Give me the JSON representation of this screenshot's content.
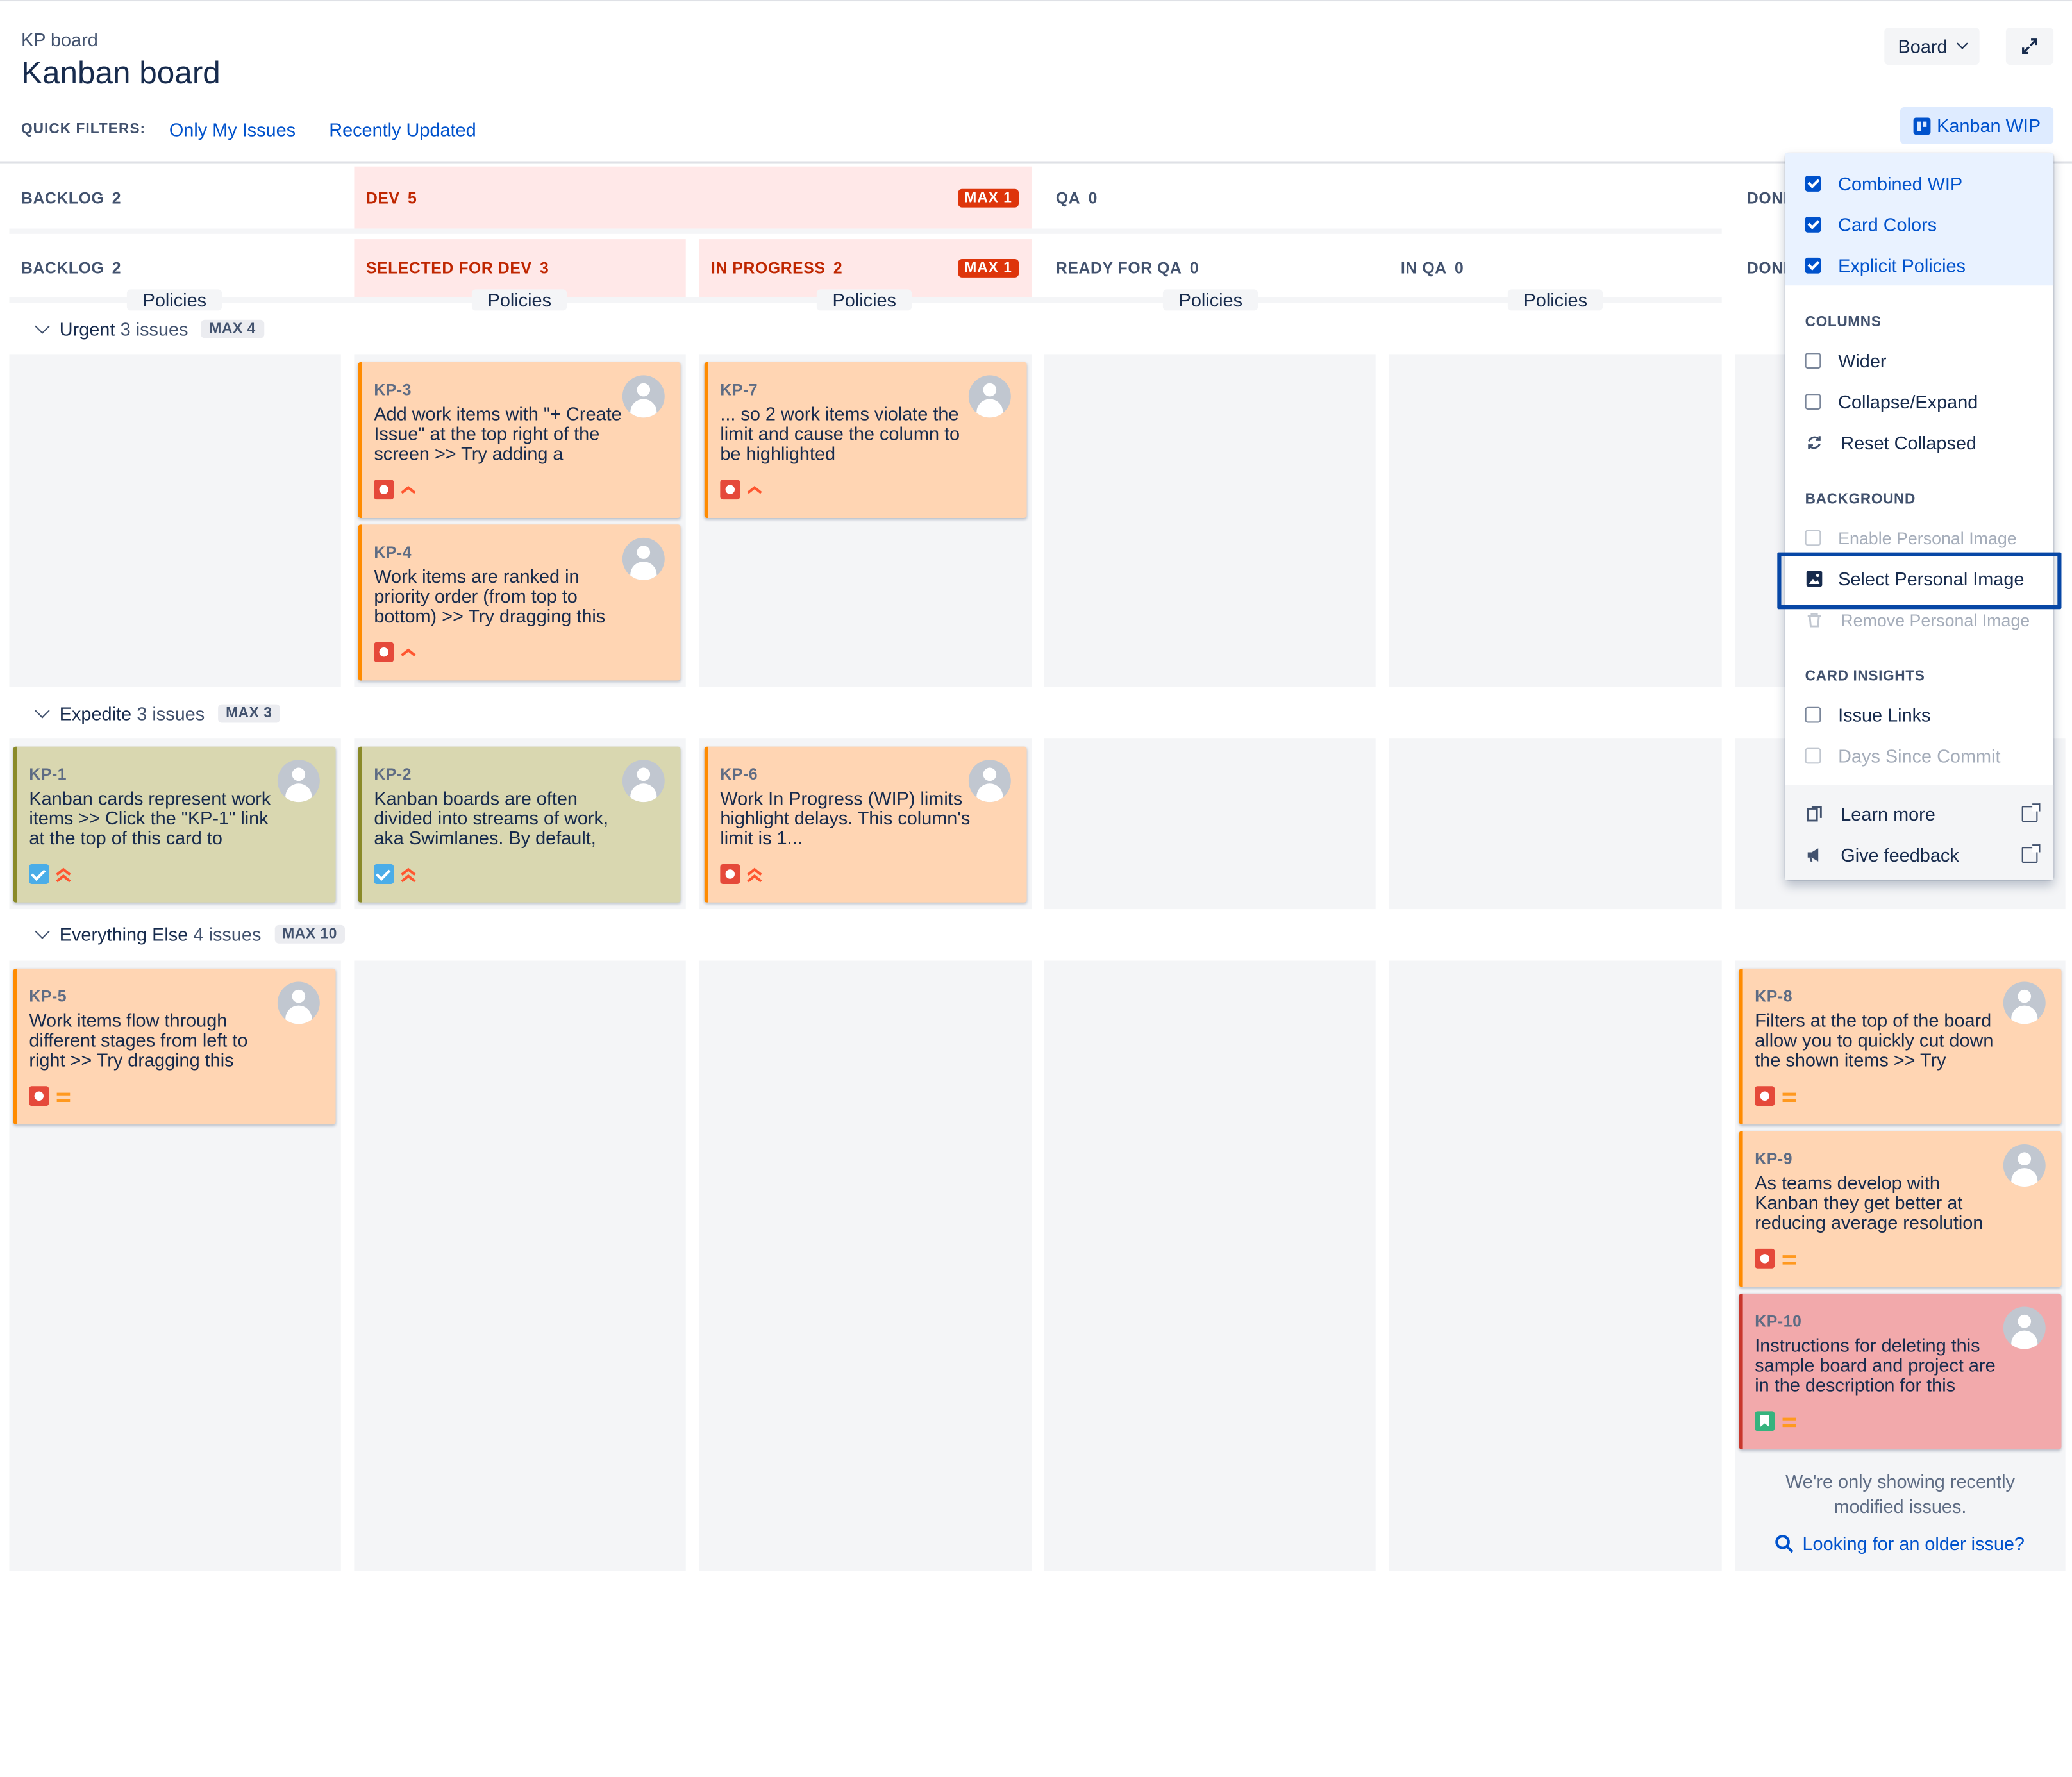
{
  "header": {
    "breadcrumb": "KP board",
    "title": "Kanban board",
    "board_button": "Board",
    "kanban_wip_button": "Kanban WIP"
  },
  "quick_filters": {
    "label": "QUICK FILTERS:",
    "items": [
      "Only My Issues",
      "Recently Updated"
    ]
  },
  "columns": {
    "groups": [
      {
        "name": "BACKLOG",
        "count": "2"
      },
      {
        "name": "DEV",
        "count": "5",
        "max": "MAX 1"
      },
      {
        "name": "QA",
        "count": "0"
      },
      {
        "name": "DONE"
      }
    ],
    "sub": [
      {
        "name": "BACKLOG",
        "count": "2"
      },
      {
        "name": "SELECTED FOR DEV",
        "count": "3"
      },
      {
        "name": "IN PROGRESS",
        "count": "2",
        "max": "MAX 1"
      },
      {
        "name": "READY FOR QA",
        "count": "0"
      },
      {
        "name": "IN QA",
        "count": "0"
      },
      {
        "name": "DONE"
      }
    ],
    "policies_label": "Policies"
  },
  "swimlanes": [
    {
      "name": "Urgent",
      "issues": "3 issues",
      "max": "MAX 4"
    },
    {
      "name": "Expedite",
      "issues": "3 issues",
      "max": "MAX 3"
    },
    {
      "name": "Everything Else",
      "issues": "4 issues",
      "max": "MAX 10"
    }
  ],
  "cards": {
    "kp3": {
      "key": "KP-3",
      "summary": "Add work items with \"+ Create Issue\" at the top right of the screen >> Try adding a",
      "type": "bug",
      "priority": "high"
    },
    "kp4": {
      "key": "KP-4",
      "summary": "Work items are ranked in priority order (from top to bottom) >> Try dragging this",
      "type": "bug",
      "priority": "high"
    },
    "kp7": {
      "key": "KP-7",
      "summary": "... so 2 work items violate the limit and cause the column to be highlighted",
      "type": "bug",
      "priority": "high"
    },
    "kp1": {
      "key": "KP-1",
      "summary": "Kanban cards represent work items >> Click the \"KP-1\" link at the top of this card to",
      "type": "task",
      "priority": "highest"
    },
    "kp2": {
      "key": "KP-2",
      "summary": "Kanban boards are often divided into streams of work, aka Swimlanes. By default,",
      "type": "task",
      "priority": "highest"
    },
    "kp6": {
      "key": "KP-6",
      "summary": "Work In Progress (WIP) limits highlight delays. This column's limit is 1...",
      "type": "bug",
      "priority": "highest"
    },
    "kp5": {
      "key": "KP-5",
      "summary": "Work items flow through different stages from left to right >> Try dragging this",
      "type": "bug",
      "priority": "medium"
    },
    "kp8": {
      "key": "KP-8",
      "summary": "Filters at the top of the board allow you to quickly cut down the shown items >> Try",
      "type": "bug",
      "priority": "medium"
    },
    "kp9": {
      "key": "KP-9",
      "summary": "As teams develop with Kanban they get better at reducing average resolution",
      "type": "bug",
      "priority": "medium"
    },
    "kp10": {
      "key": "KP-10",
      "summary": "Instructions for deleting this sample board and project are in the description for this",
      "type": "story",
      "priority": "medium"
    }
  },
  "done_footer": {
    "note": "We're only showing recently modified issues.",
    "link": "Looking for an older issue?"
  },
  "menu": {
    "top_items": [
      {
        "label": "Combined WIP",
        "checked": true
      },
      {
        "label": "Card Colors",
        "checked": true
      },
      {
        "label": "Explicit Policies",
        "checked": true
      }
    ],
    "columns_section": "COLUMNS",
    "columns_items": [
      {
        "label": "Wider",
        "checked": false
      },
      {
        "label": "Collapse/Expand",
        "checked": false
      },
      {
        "label": "Reset Collapsed"
      }
    ],
    "background_section": "BACKGROUND",
    "background_items": [
      {
        "label": "Enable Personal Image",
        "disabled": true
      },
      {
        "label": "Select Personal Image"
      },
      {
        "label": "Remove Personal Image",
        "disabled": true
      }
    ],
    "insights_section": "CARD INSIGHTS",
    "insights_items": [
      {
        "label": "Issue Links",
        "checked": false
      },
      {
        "label": "Days Since Commit",
        "disabled": true
      }
    ],
    "footer_items": [
      "Learn more",
      "Give feedback"
    ]
  },
  "colors": {
    "accent": "#0052cc",
    "wip_exceeded": "#de350b",
    "card_bug": "#ffd5b3",
    "card_task": "#d9d7b0",
    "card_story": "#f2a9ab",
    "highlight_outline": "#0747a6"
  }
}
